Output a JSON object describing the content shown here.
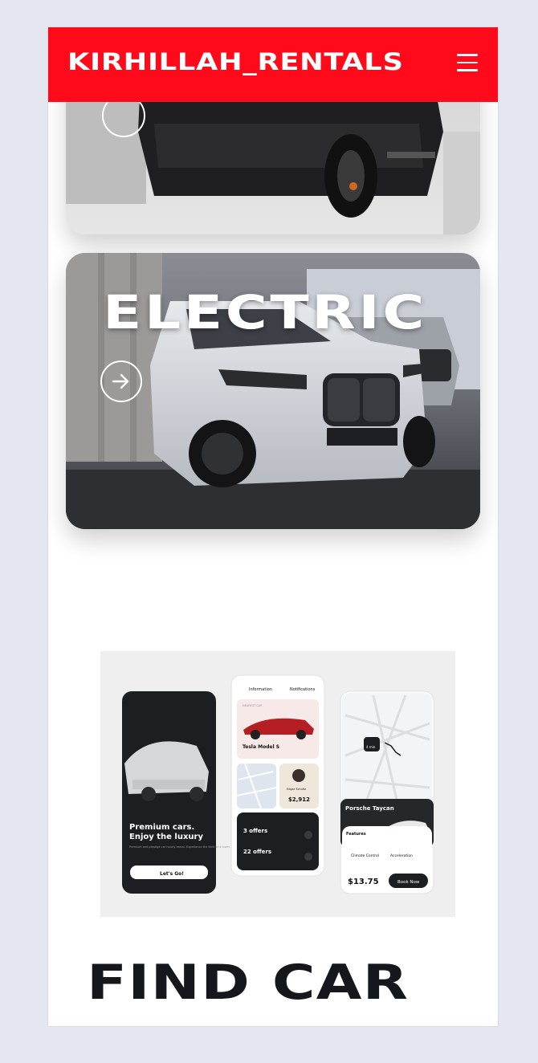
{
  "header": {
    "brand": "KIRHILLAH_RENTALS",
    "menu_icon": "hamburger-menu-icon"
  },
  "categories": [
    {
      "title": "",
      "image": "black SUV front photo",
      "action_icon": "arrow-right-icon"
    },
    {
      "title": "ELECTRIC",
      "image": "white SUV in showroom",
      "action_icon": "arrow-right-icon"
    }
  ],
  "promo": {
    "phone1": {
      "headline1": "Premium cars.",
      "headline2": "Enjoy the luxury",
      "body": "Premium and prestige car hourly rental. Experience the thrill at a lower price.",
      "cta": "Let's Go!"
    },
    "phone2": {
      "tab1": "Information",
      "tab2": "Notifications",
      "car_label": "NEAREST CAR",
      "car_name": "Tesla Model S",
      "driver_name": "Edgar Schultz",
      "price": "$2,912",
      "offers1": "3 offers",
      "offers2": "22 offers"
    },
    "phone3": {
      "pin_time": "4 min",
      "car_name": "Porsche Taycan",
      "features_title": "Features",
      "feature1": "Climate Control",
      "feature2": "Acceleration",
      "price": "$13.75",
      "book": "Book Now"
    }
  },
  "section_heading": "FIND CAR"
}
